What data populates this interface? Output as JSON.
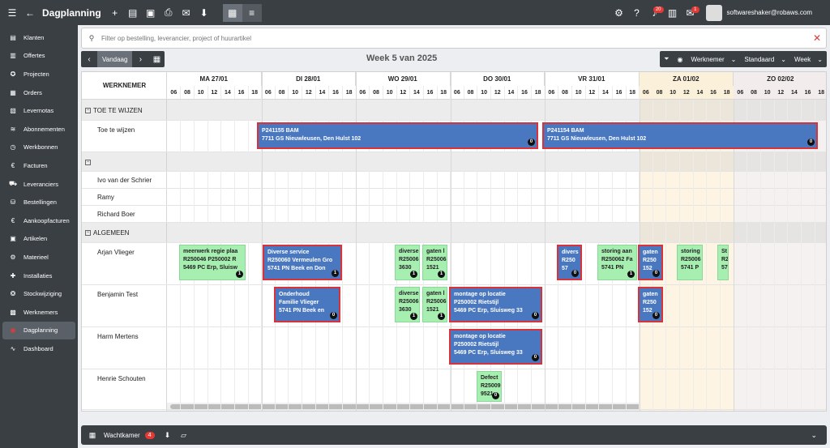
{
  "topbar": {
    "title": "Dagplanning",
    "user_email": "softwareshaker@robaws.com",
    "notification_count": "20",
    "message_count": "1"
  },
  "sidebar": {
    "items": [
      {
        "label": "Klanten",
        "icon": "users-icon",
        "glyph": "▤"
      },
      {
        "label": "Offertes",
        "icon": "quote-icon",
        "glyph": "▥"
      },
      {
        "label": "Projecten",
        "icon": "project-icon",
        "glyph": "✪"
      },
      {
        "label": "Orders",
        "icon": "orders-icon",
        "glyph": "▦"
      },
      {
        "label": "Levernotas",
        "icon": "delivery-note-icon",
        "glyph": "▧"
      },
      {
        "label": "Abonnementen",
        "icon": "subscription-icon",
        "glyph": "≋"
      },
      {
        "label": "Werkbonnen",
        "icon": "workorder-icon",
        "glyph": "◷"
      },
      {
        "label": "Facturen",
        "icon": "invoice-icon",
        "glyph": "€"
      },
      {
        "label": "Leveranciers",
        "icon": "supplier-icon",
        "glyph": "⛟"
      },
      {
        "label": "Bestellingen",
        "icon": "cart-icon",
        "glyph": "⛁"
      },
      {
        "label": "Aankoopfacturen",
        "icon": "purchase-invoice-icon",
        "glyph": "€"
      },
      {
        "label": "Artikelen",
        "icon": "article-icon",
        "glyph": "▣"
      },
      {
        "label": "Materieel",
        "icon": "equipment-icon",
        "glyph": "⚙"
      },
      {
        "label": "Installaties",
        "icon": "installation-icon",
        "glyph": "✚"
      },
      {
        "label": "Stockwijziging",
        "icon": "stock-icon",
        "glyph": "❂"
      },
      {
        "label": "Werknemers",
        "icon": "employees-icon",
        "glyph": "▩"
      },
      {
        "label": "Dagplanning",
        "icon": "dayplanning-icon",
        "glyph": "◉",
        "active": true
      },
      {
        "label": "Dashboard",
        "icon": "dashboard-icon",
        "glyph": "∿"
      }
    ]
  },
  "search": {
    "placeholder": "Filter op bestelling, leverancier, project of huurartikel"
  },
  "nav": {
    "today_label": "Vandaag"
  },
  "week_title": "Week 5 van 2025",
  "filters": {
    "group_by": "Werknemer",
    "mode": "Standaard",
    "range": "Week"
  },
  "grid": {
    "name_header": "WERKNEMER",
    "days": [
      {
        "label": "MA 27/01",
        "weekend": false
      },
      {
        "label": "DI 28/01",
        "weekend": false
      },
      {
        "label": "WO 29/01",
        "weekend": false
      },
      {
        "label": "DO 30/01",
        "weekend": false
      },
      {
        "label": "VR 31/01",
        "weekend": false
      },
      {
        "label": "ZA 01/02",
        "weekend": "sat"
      },
      {
        "label": "ZO 02/02",
        "weekend": "sun"
      }
    ],
    "hours": [
      "06",
      "08",
      "10",
      "12",
      "14",
      "16",
      "18"
    ]
  },
  "rows": [
    {
      "type": "group",
      "label": "TOE TE WIJZEN"
    },
    {
      "type": "employee",
      "label": "Toe te wijzen"
    },
    {
      "type": "group",
      "label": ""
    },
    {
      "type": "employee",
      "label": "Ivo van der Schrier"
    },
    {
      "type": "employee",
      "label": "Ramy"
    },
    {
      "type": "employee",
      "label": "Richard Boer"
    },
    {
      "type": "group",
      "label": "ALGEMEEN"
    },
    {
      "type": "employee",
      "label": "Arjan Vlieger"
    },
    {
      "type": "employee",
      "label": "Benjamin Test"
    },
    {
      "type": "employee",
      "label": "Harm Mertens"
    },
    {
      "type": "employee",
      "label": "Henrie Schouten"
    }
  ],
  "events": [
    {
      "row": 1,
      "color": "blue",
      "lines": [
        "P241155 BAM",
        "7711 GS Nieuwleusen, Den Hulst 102"
      ],
      "badge": "0"
    },
    {
      "row": 1,
      "color": "blue",
      "lines": [
        "P241154 BAM",
        "7711 GS Nieuwleusen, Den Hulst 102"
      ],
      "badge": "0"
    },
    {
      "row": 7,
      "color": "green",
      "lines": [
        "meerwerk regie plaa",
        "R250046 P250002 R",
        "5469 PC Erp, Sluisw"
      ],
      "badge": "1"
    },
    {
      "row": 7,
      "color": "blue",
      "lines": [
        "Diverse service",
        "R250060 Vermeulen Gro",
        "5741 PN Beek en Don"
      ],
      "badge": "1"
    },
    {
      "row": 7,
      "color": "green",
      "lines": [
        "diverse",
        "R25006",
        "3630"
      ],
      "badge": "1"
    },
    {
      "row": 7,
      "color": "green",
      "lines": [
        "gaten l",
        "R25006",
        "1521"
      ],
      "badge": "1"
    },
    {
      "row": 7,
      "color": "blue",
      "lines": [
        "divers",
        "R250",
        "57"
      ],
      "badge": "0"
    },
    {
      "row": 7,
      "color": "green",
      "lines": [
        "storing aan",
        "R250062 Fa",
        "5741 PN"
      ],
      "badge": "1"
    },
    {
      "row": 7,
      "color": "blue",
      "lines": [
        "gaten",
        "R250",
        "152"
      ],
      "badge": "0"
    },
    {
      "row": 7,
      "color": "green",
      "lines": [
        "storing",
        "R25006",
        "5741 P"
      ],
      "badge": ""
    },
    {
      "row": 7,
      "color": "green",
      "lines": [
        "St",
        "R2",
        "57"
      ],
      "badge": ""
    },
    {
      "row": 8,
      "color": "blue",
      "lines": [
        "Onderhoud",
        "Familie Vlieger",
        "5741 PN Beek en"
      ],
      "badge": "0"
    },
    {
      "row": 8,
      "color": "green",
      "lines": [
        "diverse",
        "R25006",
        "3630"
      ],
      "badge": "1"
    },
    {
      "row": 8,
      "color": "green",
      "lines": [
        "gaten l",
        "R25006",
        "1521"
      ],
      "badge": "1"
    },
    {
      "row": 8,
      "color": "blue",
      "lines": [
        "montage op locatie",
        "P250002 Rietstijl",
        "5469 PC Erp, Sluisweg 33"
      ],
      "badge": "0"
    },
    {
      "row": 8,
      "color": "blue",
      "lines": [
        "gaten",
        "R250",
        "152"
      ],
      "badge": "0"
    },
    {
      "row": 9,
      "color": "blue",
      "lines": [
        "montage op locatie",
        "P250002 Rietstijl",
        "5469 PC Erp, Sluisweg 33"
      ],
      "badge": "0"
    },
    {
      "row": 10,
      "color": "green",
      "lines": [
        "Defect",
        "R25009",
        "9521"
      ],
      "badge": "0"
    }
  ],
  "bottombar": {
    "label": "Wachtkamer",
    "count": "4"
  }
}
